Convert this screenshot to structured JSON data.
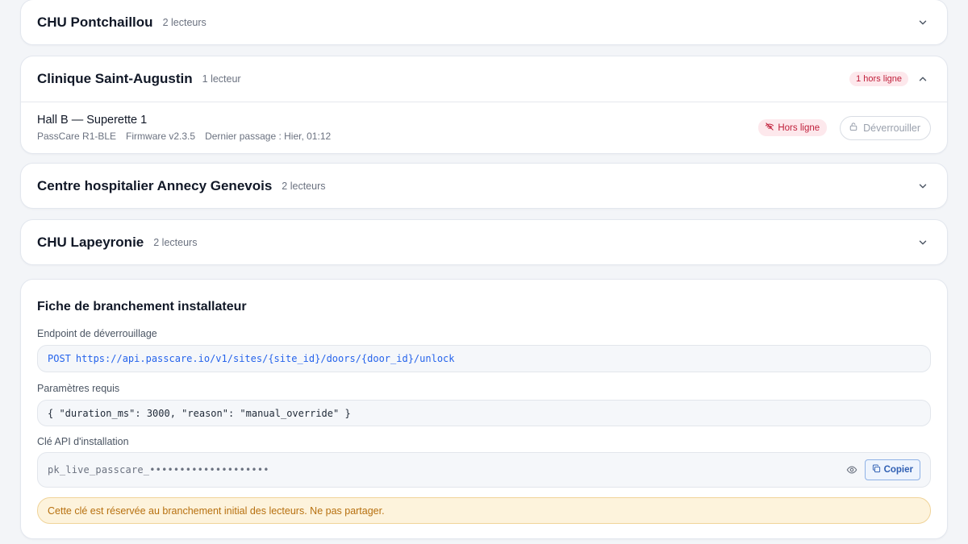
{
  "sites": [
    {
      "name": "CHU Pontchaillou",
      "count": "2 lecteurs"
    },
    {
      "name": "Clinique Saint-Augustin",
      "count": "1 lecteur",
      "offline_pill": "1 hors ligne",
      "reader": {
        "title": "Hall B — Superette 1",
        "model": "PassCare R1-BLE",
        "firmware": "Firmware v2.3.5",
        "last_pass": "Dernier passage : Hier, 01:12",
        "status": "Hors ligne",
        "unlock_label": "Déverrouiller"
      }
    },
    {
      "name": "Centre hospitalier Annecy Genevois",
      "count": "2 lecteurs"
    },
    {
      "name": "CHU Lapeyronie",
      "count": "2 lecteurs"
    }
  ],
  "install": {
    "title": "Fiche de branchement installateur",
    "endpoint_label": "Endpoint de déverrouillage",
    "endpoint_method": "POST",
    "endpoint_url": "https://api.passcare.io/v1/sites/{site_id}/doors/{door_id}/unlock",
    "params_label": "Paramètres requis",
    "params_json": "{ \"duration_ms\": 3000, \"reason\": \"manual_override\" }",
    "apikey_label": "Clé API d'installation",
    "apikey_masked": "pk_live_passcare_••••••••••••••••••••",
    "copy_label": "Copier",
    "warning": "Cette clé est réservée au branchement initial des lecteurs. Ne pas partager."
  },
  "colors": {
    "accent": "#2563eb",
    "danger_bg": "#fde8ec",
    "danger_text": "#c0203b",
    "warning_bg": "#fdf3dc",
    "warning_text": "#b7700f"
  }
}
